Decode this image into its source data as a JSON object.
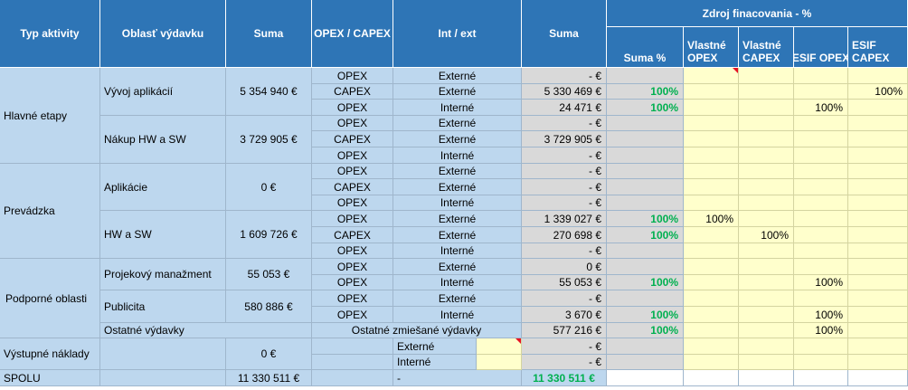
{
  "headers": {
    "typ_aktivity": "Typ aktivity",
    "oblast": "Oblasť výdavku",
    "suma": "Suma",
    "opex_capex": "OPEX / CAPEX",
    "int_ext": "Int / ext",
    "suma2": "Suma",
    "zdroj": "Zdroj finacovania - %",
    "suma_pct": "Suma %",
    "vlastne_opex": "Vlastné OPEX",
    "vlastne_capex": "Vlastné CAPEX",
    "esif_opex": "ESIF OPEX",
    "esif_capex": "ESIF CAPEX"
  },
  "groups": {
    "hlavne": "Hlavné etapy",
    "prevadzka": "Prevádzka",
    "podporne": "Podporné oblasti",
    "vystupne": "Výstupné náklady",
    "spolu": "SPOLU"
  },
  "areas": {
    "vyvoj": {
      "label": "Vývoj aplikácií",
      "sum": "5 354 940 €"
    },
    "nakup": {
      "label": "Nákup HW a SW",
      "sum": "3 729 905 €"
    },
    "aplikacie": {
      "label": "Aplikácie",
      "sum": "0 €"
    },
    "hw_sw": {
      "label": "HW a SW",
      "sum": "1 609 726 €"
    },
    "projekovy": {
      "label": "Projekový manažment",
      "sum": "55 053 €"
    },
    "publicita": {
      "label": "Publicita",
      "sum": "580 886 €"
    },
    "ostatne": {
      "label": "Ostatné výdavky"
    },
    "vystupne": {
      "sum": "0 €"
    },
    "spolu": {
      "sum": "11 330 511 €"
    }
  },
  "rows": [
    {
      "type": "OPEX",
      "ie": "Externé",
      "sum": "- €",
      "pct": "",
      "v_opex": "",
      "v_capex": "",
      "e_opex": "",
      "e_capex": ""
    },
    {
      "type": "CAPEX",
      "ie": "Externé",
      "sum": "5 330 469 €",
      "pct": "100%",
      "v_opex": "",
      "v_capex": "",
      "e_opex": "",
      "e_capex": "100%"
    },
    {
      "type": "OPEX",
      "ie": "Interné",
      "sum": "24 471 €",
      "pct": "100%",
      "v_opex": "",
      "v_capex": "",
      "e_opex": "100%",
      "e_capex": ""
    },
    {
      "type": "OPEX",
      "ie": "Externé",
      "sum": "- €",
      "pct": "",
      "v_opex": "",
      "v_capex": "",
      "e_opex": "",
      "e_capex": ""
    },
    {
      "type": "CAPEX",
      "ie": "Externé",
      "sum": "3 729 905 €",
      "pct": "",
      "v_opex": "",
      "v_capex": "",
      "e_opex": "",
      "e_capex": ""
    },
    {
      "type": "OPEX",
      "ie": "Interné",
      "sum": "- €",
      "pct": "",
      "v_opex": "",
      "v_capex": "",
      "e_opex": "",
      "e_capex": ""
    },
    {
      "type": "OPEX",
      "ie": "Externé",
      "sum": "- €",
      "pct": "",
      "v_opex": "",
      "v_capex": "",
      "e_opex": "",
      "e_capex": ""
    },
    {
      "type": "CAPEX",
      "ie": "Externé",
      "sum": "- €",
      "pct": "",
      "v_opex": "",
      "v_capex": "",
      "e_opex": "",
      "e_capex": ""
    },
    {
      "type": "OPEX",
      "ie": "Interné",
      "sum": "- €",
      "pct": "",
      "v_opex": "",
      "v_capex": "",
      "e_opex": "",
      "e_capex": ""
    },
    {
      "type": "OPEX",
      "ie": "Externé",
      "sum": "1 339 027 €",
      "pct": "100%",
      "v_opex": "100%",
      "v_capex": "",
      "e_opex": "",
      "e_capex": ""
    },
    {
      "type": "CAPEX",
      "ie": "Externé",
      "sum": "270 698 €",
      "pct": "100%",
      "v_opex": "",
      "v_capex": "100%",
      "e_opex": "",
      "e_capex": ""
    },
    {
      "type": "OPEX",
      "ie": "Interné",
      "sum": "- €",
      "pct": "",
      "v_opex": "",
      "v_capex": "",
      "e_opex": "",
      "e_capex": ""
    },
    {
      "type": "OPEX",
      "ie": "Externé",
      "sum": "0 €",
      "pct": "",
      "v_opex": "",
      "v_capex": "",
      "e_opex": "",
      "e_capex": ""
    },
    {
      "type": "OPEX",
      "ie": "Interné",
      "sum": "55 053 €",
      "pct": "100%",
      "v_opex": "",
      "v_capex": "",
      "e_opex": "100%",
      "e_capex": ""
    },
    {
      "type": "OPEX",
      "ie": "Externé",
      "sum": "- €",
      "pct": "",
      "v_opex": "",
      "v_capex": "",
      "e_opex": "",
      "e_capex": ""
    },
    {
      "type": "OPEX",
      "ie": "Interné",
      "sum": "3 670 €",
      "pct": "100%",
      "v_opex": "",
      "v_capex": "",
      "e_opex": "100%",
      "e_capex": ""
    },
    {
      "merged": "Ostatné zmiešané výdavky",
      "sum": "577 216 €",
      "pct": "100%",
      "v_opex": "",
      "v_capex": "",
      "e_opex": "100%",
      "e_capex": ""
    },
    {
      "ie_small": "Externé",
      "sum": "- €"
    },
    {
      "ie_small": "Interné",
      "sum": "- €"
    },
    {
      "spolu_dash": "-",
      "sum": "11 330 511 €"
    }
  ]
}
